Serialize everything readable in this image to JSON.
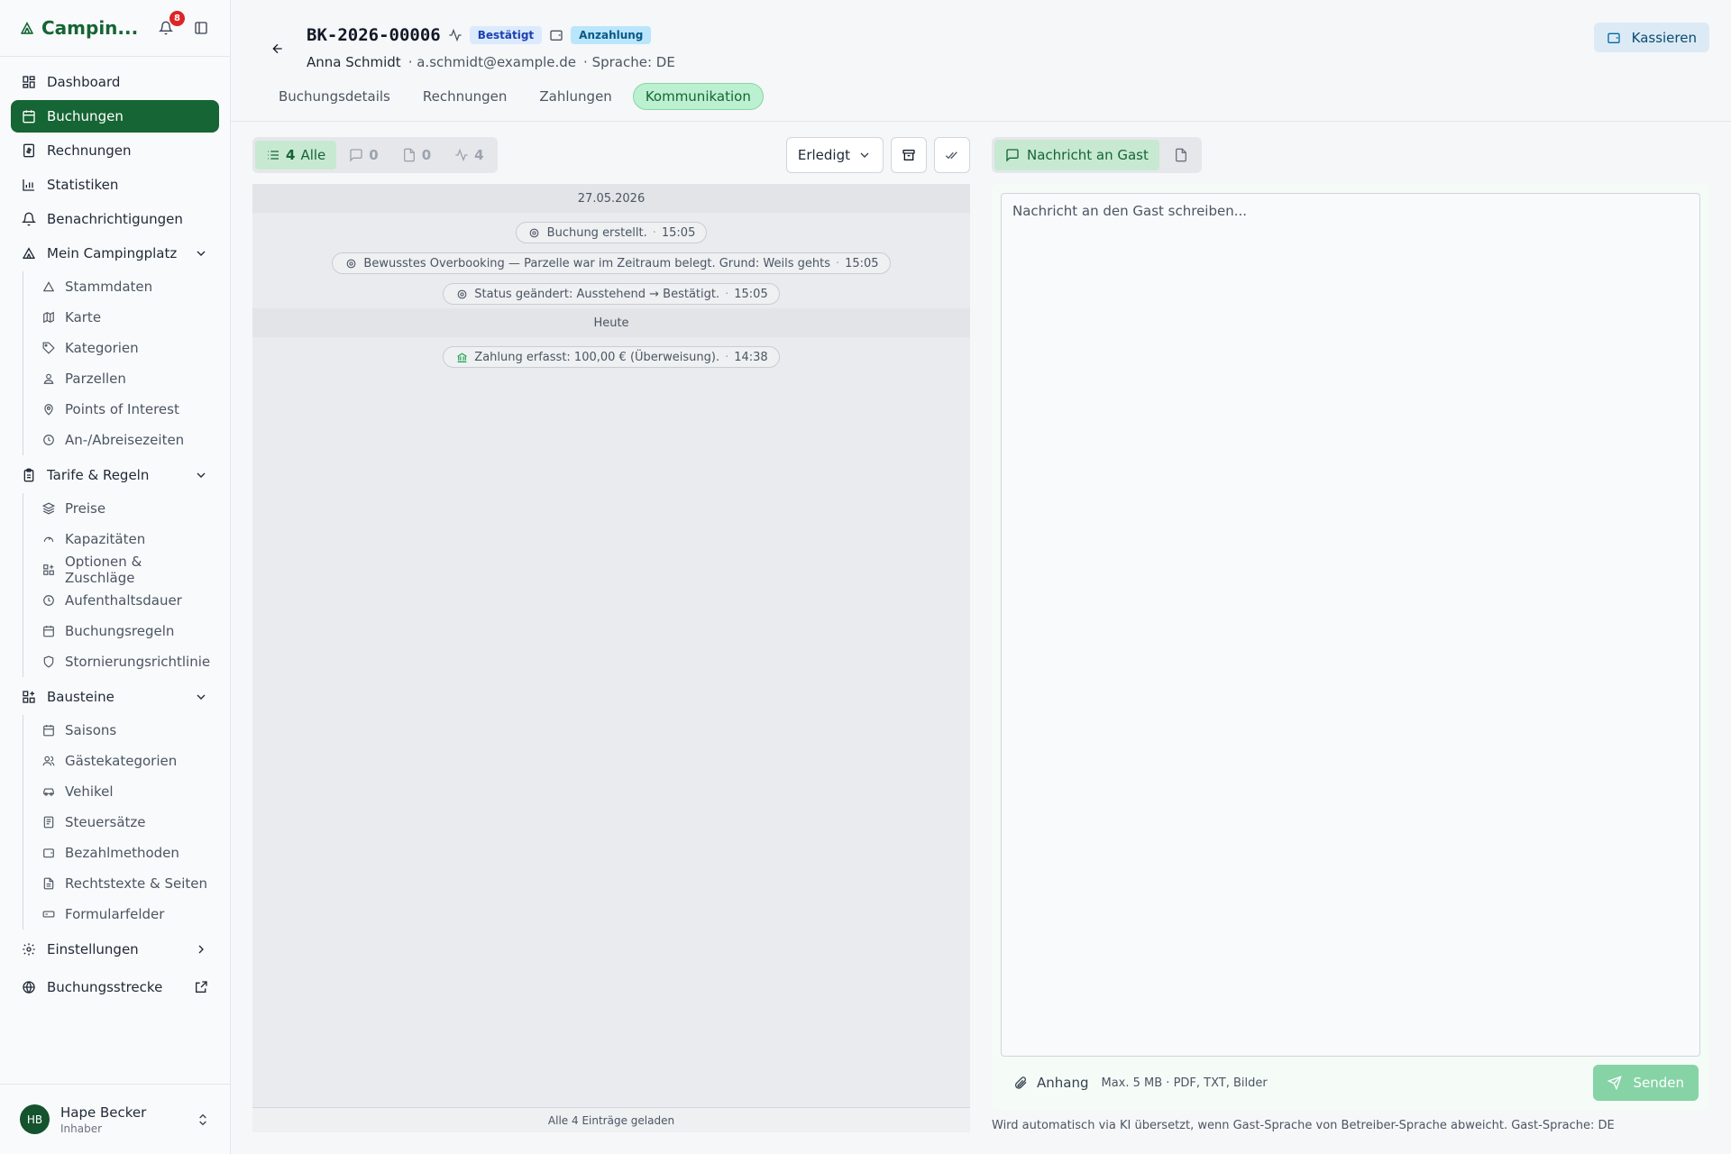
{
  "sidebar": {
    "brand": "Campin...",
    "notifications_count": "8",
    "items": [
      {
        "label": "Dashboard",
        "icon": "grid-icon"
      },
      {
        "label": "Buchungen",
        "icon": "calendar-icon"
      },
      {
        "label": "Rechnungen",
        "icon": "invoice-icon"
      },
      {
        "label": "Statistiken",
        "icon": "bar-chart-icon"
      },
      {
        "label": "Benachrichtigungen",
        "icon": "bell-icon"
      }
    ],
    "groups": [
      {
        "label": "Mein Campingplatz",
        "children": [
          "Stammdaten",
          "Karte",
          "Kategorien",
          "Parzellen",
          "Points of Interest",
          "An-/Abreisezeiten"
        ]
      },
      {
        "label": "Tarife & Regeln",
        "children": [
          "Preise",
          "Kapazitäten",
          "Optionen & Zuschläge",
          "Aufenthaltsdauer",
          "Buchungsregeln",
          "Stornierungsrichtlinie"
        ]
      },
      {
        "label": "Bausteine",
        "children": [
          "Saisons",
          "Gästekategorien",
          "Vehikel",
          "Steuersätze",
          "Bezahlmethoden",
          "Rechtstexte & Seiten",
          "Formularfelder"
        ]
      }
    ],
    "settings": "Einstellungen",
    "booking_path": "Buchungsstrecke",
    "user": {
      "initials": "HB",
      "name": "Hape Becker",
      "role": "Inhaber"
    }
  },
  "header": {
    "booking_id": "BK-2026-00006",
    "status": "Bestätigt",
    "payment_status": "Anzahlung",
    "guest_name": "Anna Schmidt",
    "guest_email": "· a.schmidt@example.de",
    "language": "· Sprache: DE",
    "cashier_button": "Kassieren",
    "tabs": [
      "Buchungsdetails",
      "Rechnungen",
      "Zahlungen",
      "Kommunikation"
    ]
  },
  "filters": {
    "all_count": "4",
    "all_label": "Alle",
    "messages_count": "0",
    "files_count": "0",
    "activity_count": "4",
    "status_select": "Erledigt"
  },
  "timeline": {
    "days": [
      {
        "date": "27.05.2026",
        "events": [
          {
            "text": "Buchung erstellt.",
            "time": "15:05",
            "icon": "gear-icon"
          },
          {
            "text": "Bewusstes Overbooking — Parzelle war im Zeitraum belegt. Grund: Weils gehts",
            "time": "15:05",
            "icon": "gear-icon"
          },
          {
            "text": "Status geändert: Ausstehend → Bestätigt.",
            "time": "15:05",
            "icon": "gear-icon"
          }
        ]
      },
      {
        "date": "Heute",
        "events": [
          {
            "text": "Zahlung erfasst: 100,00 € (Überweisung).",
            "time": "14:38",
            "icon": "bank-icon"
          }
        ]
      }
    ],
    "footer": "Alle 4 Einträge geladen"
  },
  "compose": {
    "tab_message": "Nachricht an Gast",
    "placeholder": "Nachricht an den Gast schreiben...",
    "attach_label": "Anhang",
    "attach_hint": "Max. 5 MB · PDF, TXT, Bilder",
    "send_label": "Senden",
    "note": "Wird automatisch via KI übersetzt, wenn Gast-Sprache von Betreiber-Sprache abweicht. Gast-Sprache: DE"
  },
  "colors": {
    "brand_green": "#166534",
    "active_tab_bg": "#bbf0d0",
    "confirmed_bg": "#dbeafe",
    "deposit_bg": "#bae6fd",
    "badge_red": "#dc2626"
  }
}
